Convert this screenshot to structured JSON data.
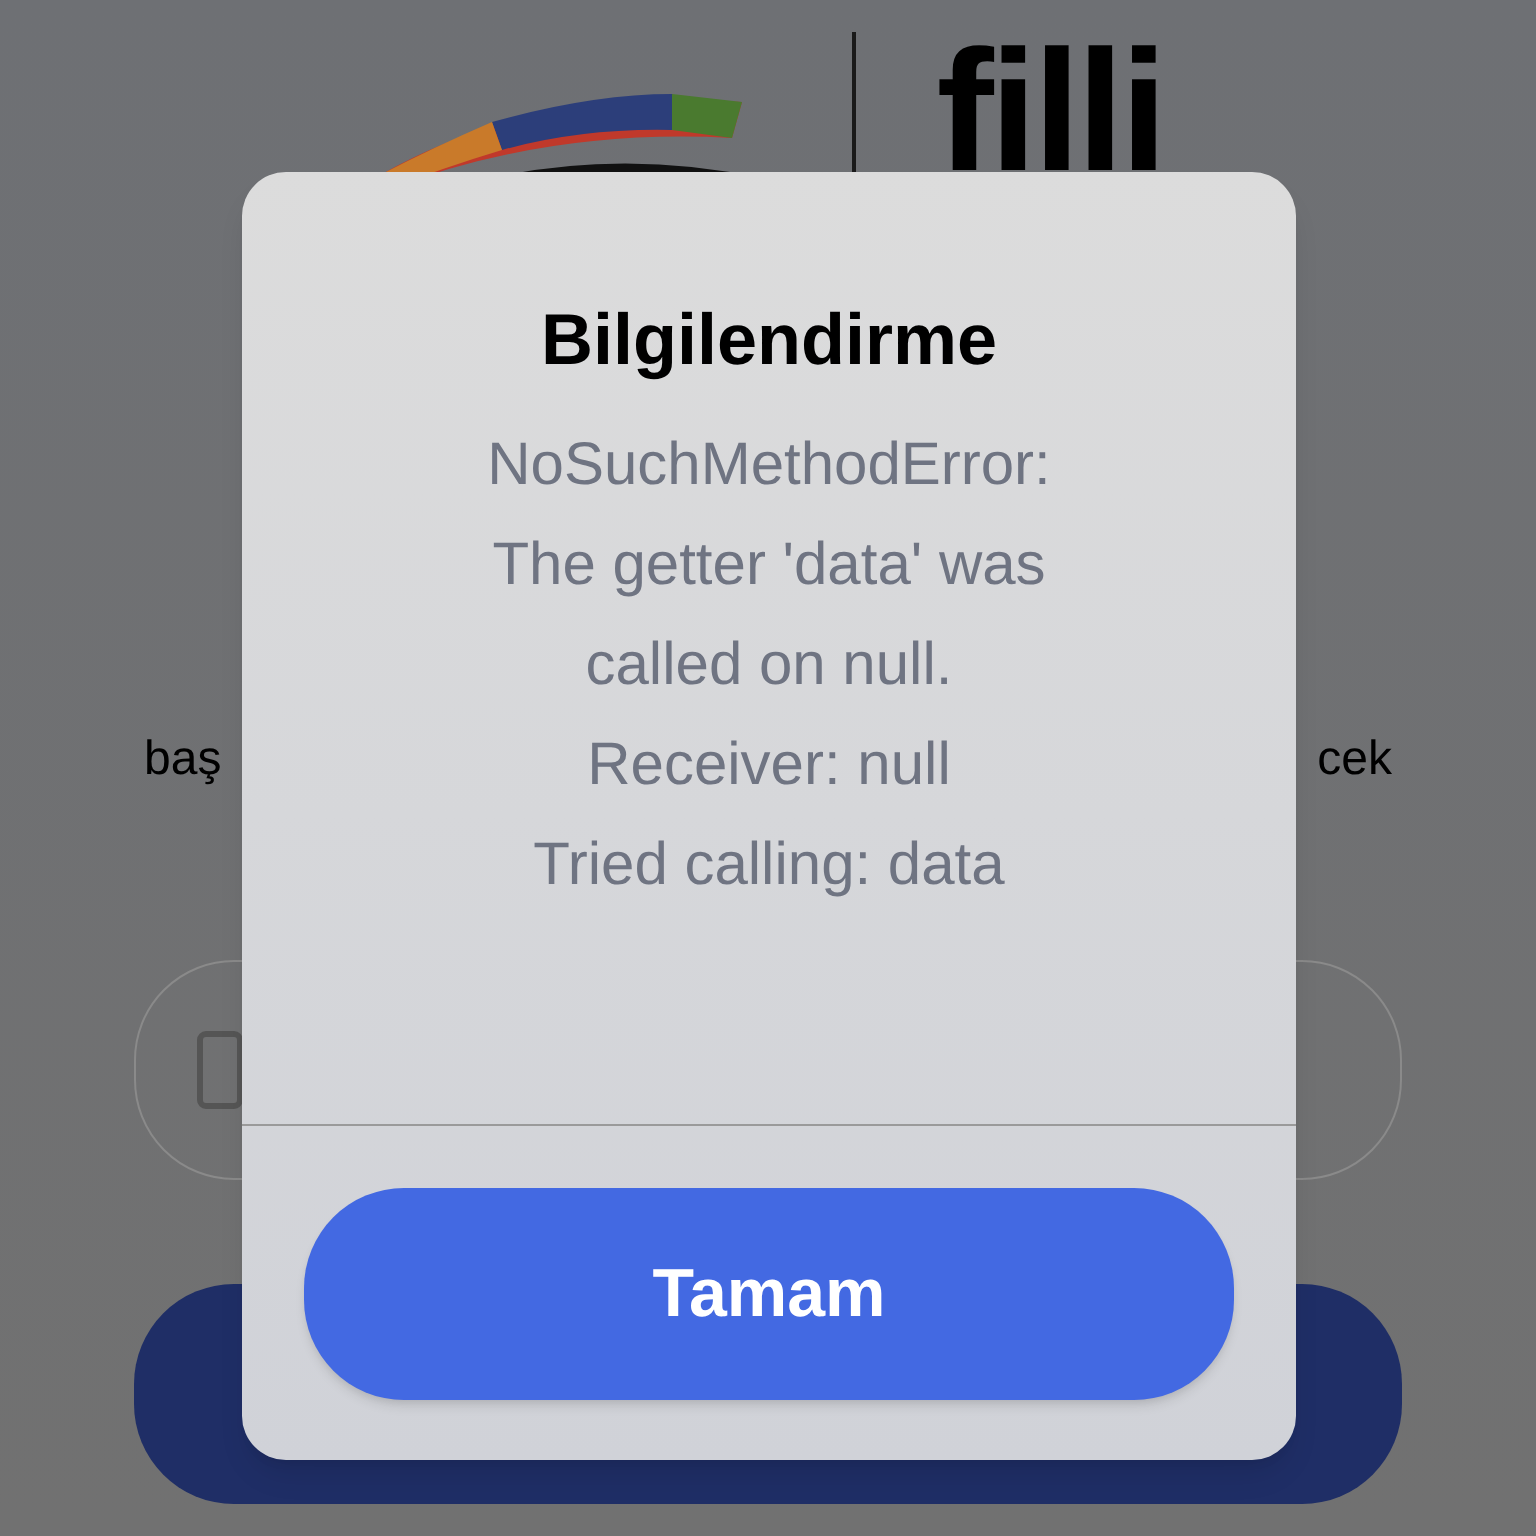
{
  "background": {
    "logo_text": "filli",
    "intro_left": "baş",
    "intro_right": "cek"
  },
  "dialog": {
    "title": "Bilgilendirme",
    "message": [
      "NoSuchMethodError:",
      "The getter 'data' was",
      "called on null.",
      "Receiver: null",
      "Tried calling: data"
    ],
    "button": "Tamam"
  }
}
